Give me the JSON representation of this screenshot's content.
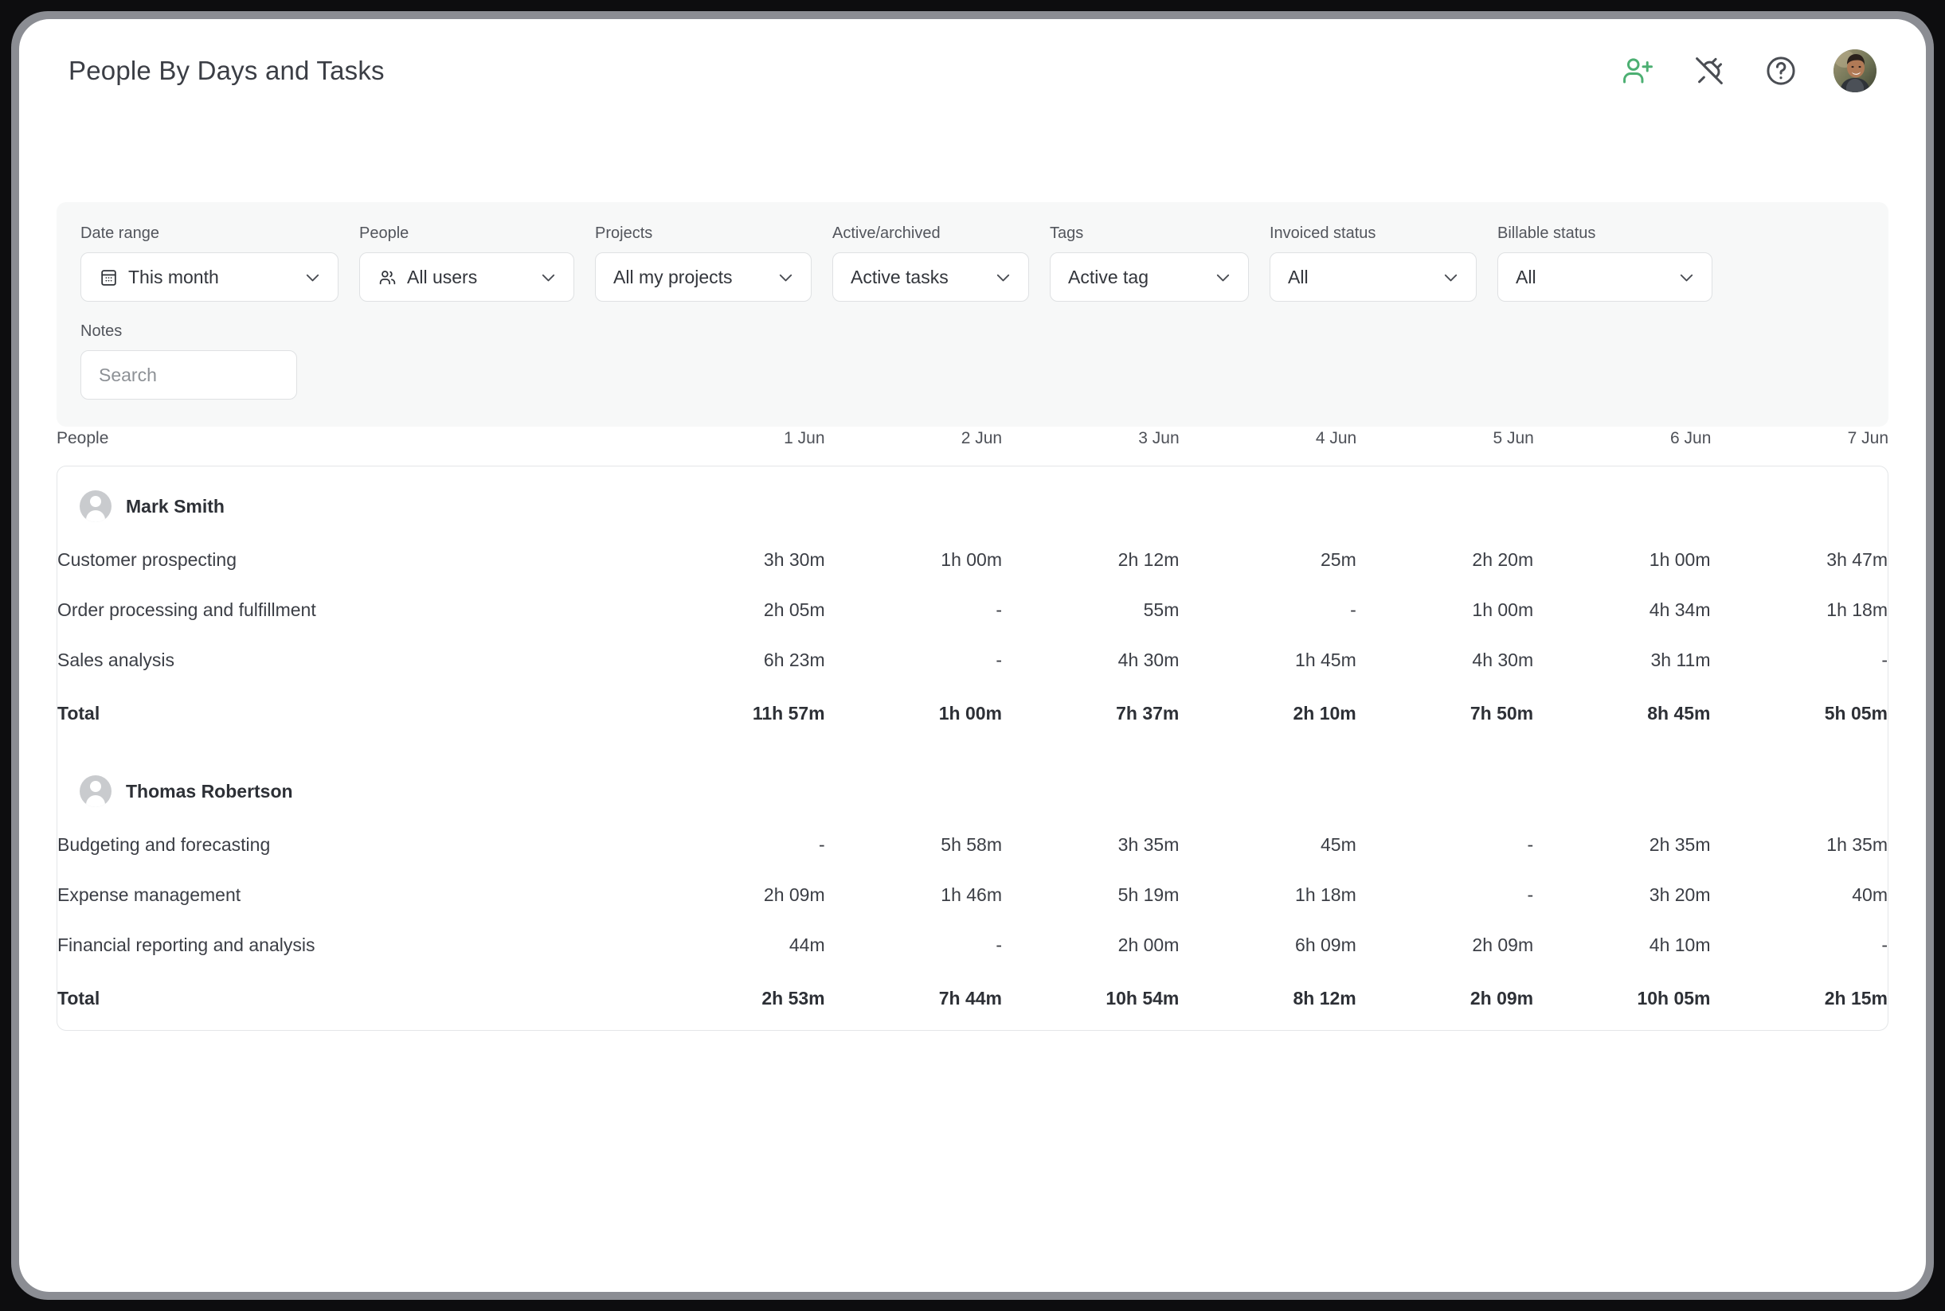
{
  "header": {
    "title": "People By Days and Tasks",
    "icons": [
      {
        "name": "add-user-icon",
        "label": "Invite people"
      },
      {
        "name": "plug-off-icon",
        "label": "Integrations"
      },
      {
        "name": "help-circle-icon",
        "label": "Help"
      }
    ],
    "avatar_name": "user-avatar"
  },
  "filters": {
    "date_range": {
      "label": "Date range",
      "value": "This month"
    },
    "people": {
      "label": "People",
      "value": "All users"
    },
    "projects": {
      "label": "Projects",
      "value": "All my projects"
    },
    "active_archived": {
      "label": "Active/archived",
      "value": "Active tasks"
    },
    "tags": {
      "label": "Tags",
      "value": "Active tag"
    },
    "invoiced_status": {
      "label": "Invoiced status",
      "value": "All"
    },
    "billable_status": {
      "label": "Billable status",
      "value": "All"
    },
    "notes": {
      "label": "Notes",
      "value": "",
      "placeholder": "Search"
    }
  },
  "table": {
    "columns": [
      "People",
      "1 Jun",
      "2 Jun",
      "3 Jun",
      "4 Jun",
      "5 Jun",
      "6 Jun",
      "7 Jun"
    ],
    "total_label": "Total",
    "empty_value": "-",
    "groups": [
      {
        "person": "Mark Smith",
        "rows": [
          {
            "task": "Customer prospecting",
            "values": [
              "3h 30m",
              "1h 00m",
              "2h 12m",
              "25m",
              "2h 20m",
              "1h 00m",
              "3h 47m"
            ]
          },
          {
            "task": "Order processing and fulfillment",
            "values": [
              "2h 05m",
              "-",
              "55m",
              "-",
              "1h 00m",
              "4h 34m",
              "1h 18m"
            ]
          },
          {
            "task": "Sales analysis",
            "values": [
              "6h 23m",
              "-",
              "4h 30m",
              "1h 45m",
              "4h 30m",
              "3h 11m",
              "-"
            ]
          }
        ],
        "totals": [
          "11h 57m",
          "1h 00m",
          "7h 37m",
          "2h 10m",
          "7h 50m",
          "8h 45m",
          "5h 05m"
        ]
      },
      {
        "person": "Thomas Robertson",
        "rows": [
          {
            "task": "Budgeting and forecasting",
            "values": [
              "-",
              "5h 58m",
              "3h 35m",
              "45m",
              "-",
              "2h 35m",
              "1h 35m"
            ]
          },
          {
            "task": "Expense management",
            "values": [
              "2h 09m",
              "1h 46m",
              "5h 19m",
              "1h 18m",
              "-",
              "3h 20m",
              "40m"
            ]
          },
          {
            "task": "Financial reporting and analysis",
            "values": [
              "44m",
              "-",
              "2h 00m",
              "6h 09m",
              "2h 09m",
              "4h 10m",
              "-"
            ]
          }
        ],
        "totals": [
          "2h 53m",
          "7h 44m",
          "10h 54m",
          "8h 12m",
          "2h 09m",
          "10h 05m",
          "2h 15m"
        ]
      }
    ]
  },
  "colors": {
    "accent_green": "#4caf72",
    "icon_gray": "#4a4d53",
    "panel_bg": "#f7f8f8",
    "border": "#e4e6e8"
  }
}
